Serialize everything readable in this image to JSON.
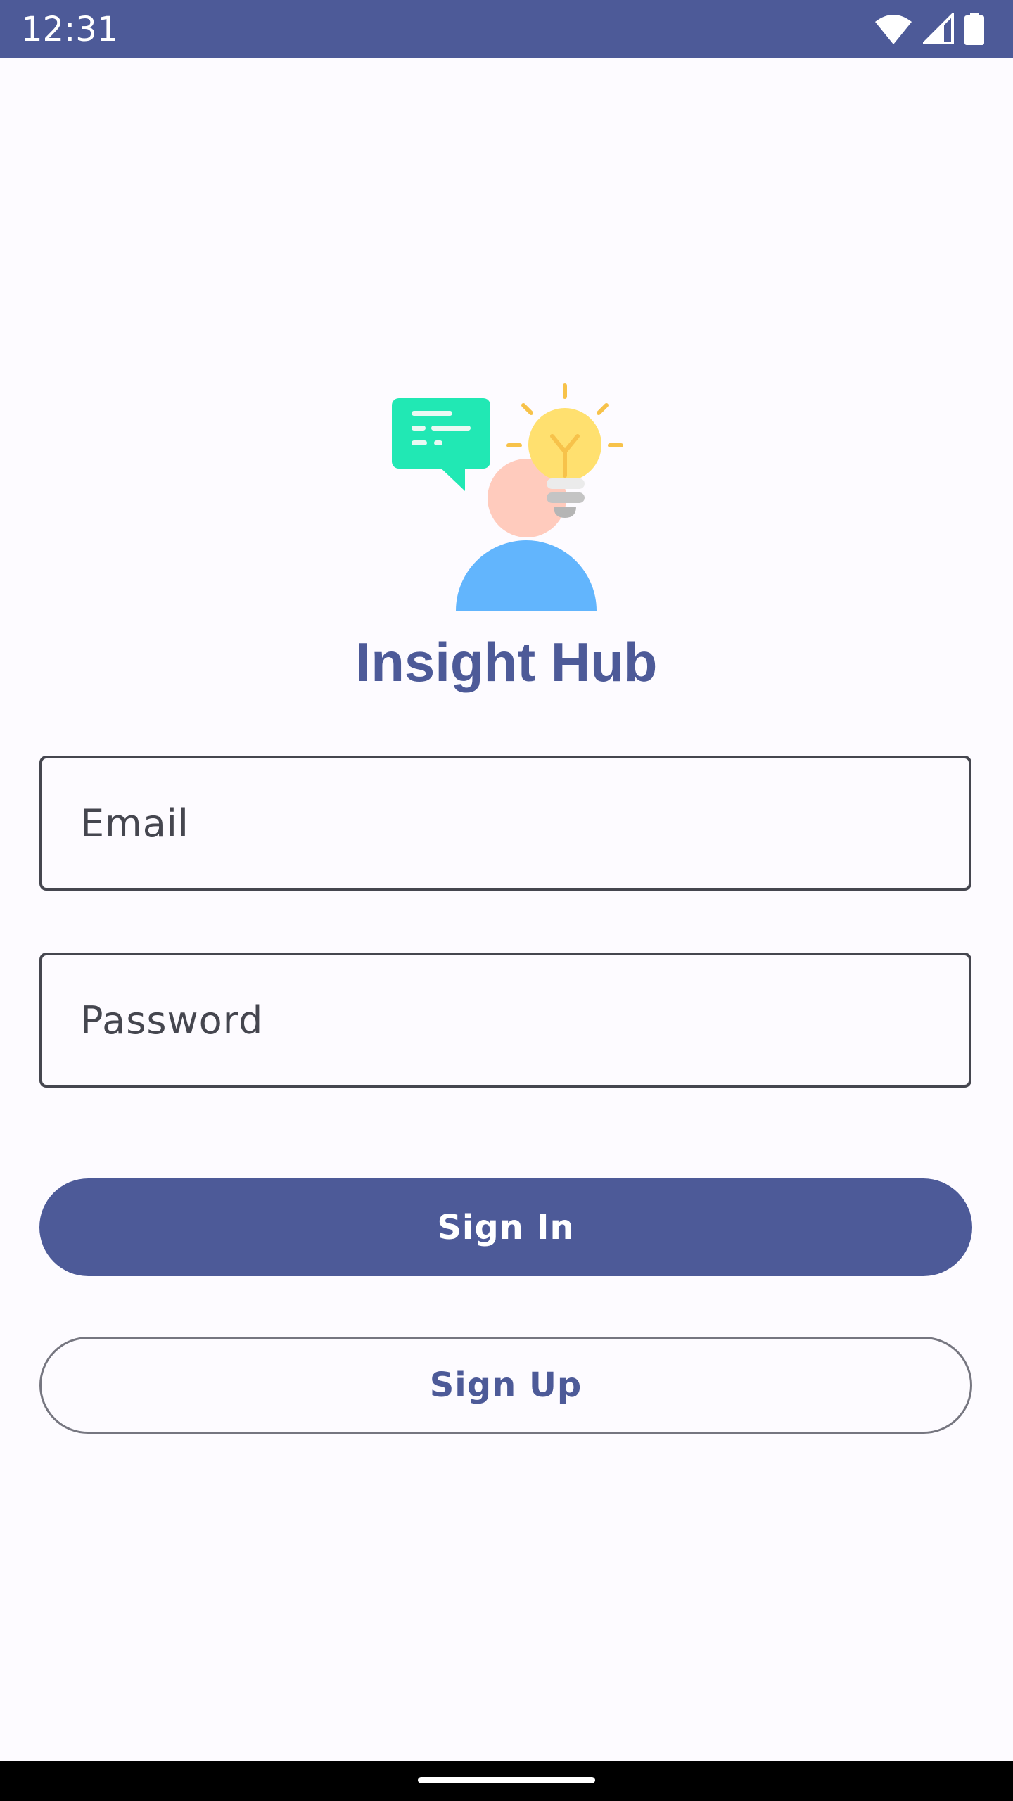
{
  "status_bar": {
    "time": "12:31",
    "icons": [
      "wifi-icon",
      "cellular-signal-icon",
      "battery-icon"
    ]
  },
  "app": {
    "title": "Insight Hub",
    "logo_icon": "person-idea-chat-icon"
  },
  "form": {
    "email_placeholder": "Email",
    "password_placeholder": "Password",
    "email_value": "",
    "password_value": ""
  },
  "buttons": {
    "sign_in": "Sign In",
    "sign_up": "Sign Up"
  },
  "colors": {
    "primary": "#4d5a98",
    "background": "#fdfbff",
    "outline": "#45464f",
    "chat_bubble": "#21e8b4",
    "bulb": "#ffe06f",
    "person_head": "#ffcbbd",
    "person_body": "#62b5fd"
  }
}
